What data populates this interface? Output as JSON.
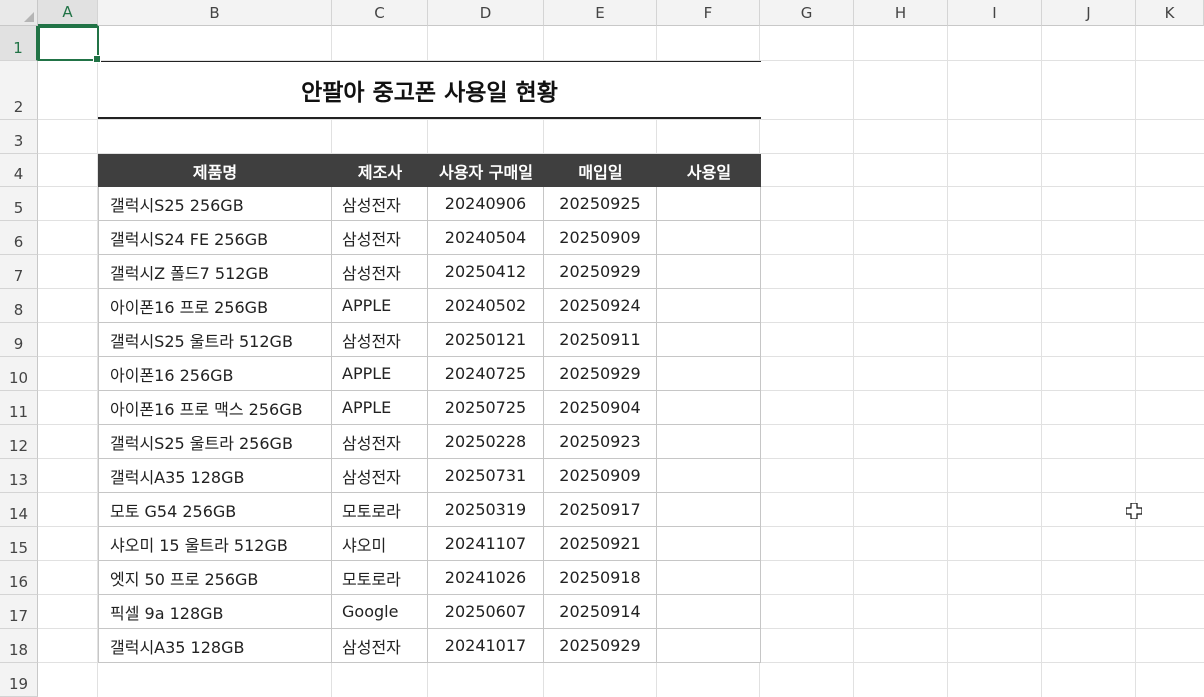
{
  "columns": [
    "A",
    "B",
    "C",
    "D",
    "E",
    "F",
    "G",
    "H",
    "I",
    "J",
    "K"
  ],
  "rows": [
    "1",
    "2",
    "3",
    "4",
    "5",
    "6",
    "7",
    "8",
    "9",
    "10",
    "11",
    "12",
    "13",
    "14",
    "15",
    "16",
    "17",
    "18",
    "19"
  ],
  "selected_cell": "A1",
  "title": "안팔아 중고폰 사용일 현황",
  "table": {
    "headers": [
      "제품명",
      "제조사",
      "사용자 구매일",
      "매입일",
      "사용일"
    ],
    "rows": [
      {
        "name": "갤럭시S25 256GB",
        "maker": "삼성전자",
        "purchase": "20240906",
        "buyback": "20250925",
        "days": ""
      },
      {
        "name": "갤럭시S24 FE 256GB",
        "maker": "삼성전자",
        "purchase": "20240504",
        "buyback": "20250909",
        "days": ""
      },
      {
        "name": "갤럭시Z 폴드7 512GB",
        "maker": "삼성전자",
        "purchase": "20250412",
        "buyback": "20250929",
        "days": ""
      },
      {
        "name": "아이폰16 프로 256GB",
        "maker": "APPLE",
        "purchase": "20240502",
        "buyback": "20250924",
        "days": ""
      },
      {
        "name": "갤럭시S25 울트라 512GB",
        "maker": "삼성전자",
        "purchase": "20250121",
        "buyback": "20250911",
        "days": ""
      },
      {
        "name": "아이폰16 256GB",
        "maker": "APPLE",
        "purchase": "20240725",
        "buyback": "20250929",
        "days": ""
      },
      {
        "name": "아이폰16 프로 맥스 256GB",
        "maker": "APPLE",
        "purchase": "20250725",
        "buyback": "20250904",
        "days": ""
      },
      {
        "name": "갤럭시S25 울트라 256GB",
        "maker": "삼성전자",
        "purchase": "20250228",
        "buyback": "20250923",
        "days": ""
      },
      {
        "name": "갤럭시A35 128GB",
        "maker": "삼성전자",
        "purchase": "20250731",
        "buyback": "20250909",
        "days": ""
      },
      {
        "name": "모토 G54 256GB",
        "maker": "모토로라",
        "purchase": "20250319",
        "buyback": "20250917",
        "days": ""
      },
      {
        "name": "샤오미 15 울트라 512GB",
        "maker": "샤오미",
        "purchase": "20241107",
        "buyback": "20250921",
        "days": ""
      },
      {
        "name": "엣지 50 프로 256GB",
        "maker": "모토로라",
        "purchase": "20241026",
        "buyback": "20250918",
        "days": ""
      },
      {
        "name": "픽셀 9a 128GB",
        "maker": "Google",
        "purchase": "20250607",
        "buyback": "20250914",
        "days": ""
      },
      {
        "name": "갤럭시A35 128GB",
        "maker": "삼성전자",
        "purchase": "20241017",
        "buyback": "20250929",
        "days": ""
      }
    ]
  },
  "colors": {
    "accent": "#217346",
    "table_header_bg": "#3f3f3f",
    "gridline": "#e1e1e1"
  },
  "icons": {
    "cursor": "cross-cursor-icon",
    "corner": "select-all-icon"
  }
}
